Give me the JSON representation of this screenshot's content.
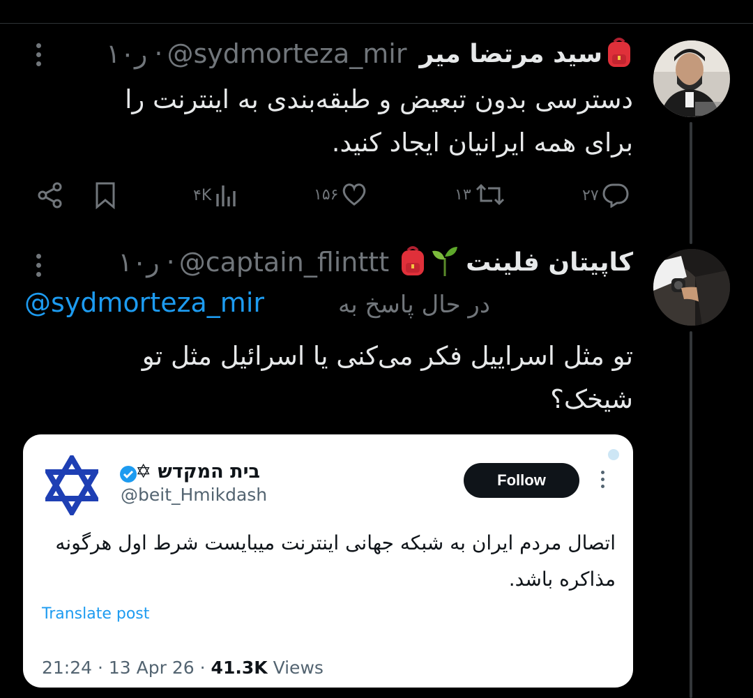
{
  "tweets": [
    {
      "name": "سید مرتضا میر",
      "handle": "@sydmorteza_mir",
      "time": "۱۰ر",
      "text_lines": [
        "دسترسی بدون تبعیض و طبقه‌بندی به اینترنت را",
        "برای همه ایرانیان ایجاد کنید."
      ],
      "stats": {
        "replies": "۲۷",
        "retweets": "۱۳",
        "likes": "۱۵۶",
        "views": "۴K"
      }
    },
    {
      "name": "کاپیتان فلینت",
      "handle": "@captain_flinttt",
      "time": "۱۰ر",
      "replying_label": "در حال پاسخ به",
      "replying_to": "@sydmorteza_mir",
      "text_lines": [
        "تو مثل اسراییل فکر می‌کنی یا اسرائیل مثل تو",
        "شیخک؟"
      ]
    }
  ],
  "quoted": {
    "name": "בית המקדש ✡",
    "handle": "@beit_Hmikdash",
    "follow_label": "Follow",
    "text_lines": [
      "اتصال مردم ایران به شبکه جهانی اینترنت میبایست شرط اول هرگونه",
      "مذاکره باشد."
    ],
    "translate_label": "Translate post",
    "time": "21:24",
    "date": "13 Apr 26",
    "views_count": "41.3K",
    "views_label": "Views"
  },
  "colors": {
    "accent": "#1d9bf0",
    "muted": "#71767b",
    "star": "#1e3fb4"
  }
}
